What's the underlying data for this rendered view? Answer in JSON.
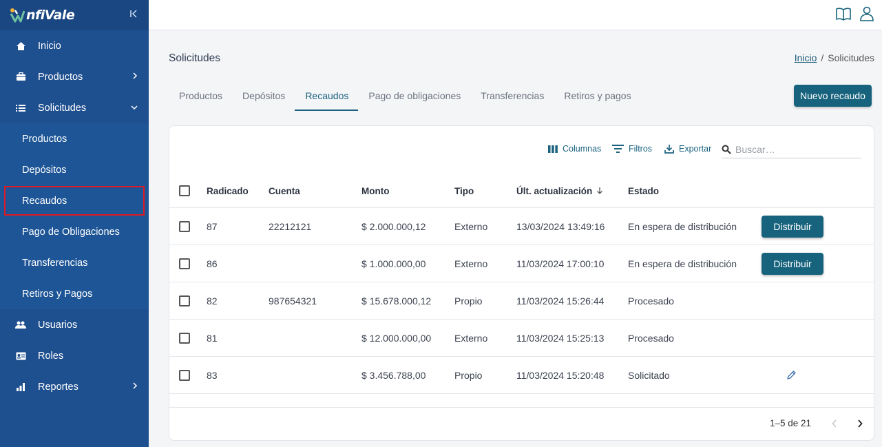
{
  "app": {
    "logo_text": "nfiVale",
    "brand_color": "#1e4f8f",
    "accent": "#17637d"
  },
  "sidebar": {
    "items": [
      {
        "label": "Inicio",
        "icon": "home-icon"
      },
      {
        "label": "Productos",
        "icon": "briefcase-icon"
      },
      {
        "label": "Solicitudes",
        "icon": "list-icon"
      }
    ],
    "subitems": [
      "Productos",
      "Depósitos",
      "Recaudos",
      "Pago de Obligaciones",
      "Transferencias",
      "Retiros y Pagos"
    ],
    "bottom_items": [
      {
        "label": "Usuarios",
        "icon": "users-icon"
      },
      {
        "label": "Roles",
        "icon": "id-card-icon"
      },
      {
        "label": "Reportes",
        "icon": "chart-icon"
      }
    ]
  },
  "page": {
    "title": "Solicitudes",
    "breadcrumb": {
      "home": "Inicio",
      "sep": "/",
      "current": "Solicitudes"
    }
  },
  "tabs": [
    "Productos",
    "Depósitos",
    "Recaudos",
    "Pago de obligaciones",
    "Transferencias",
    "Retiros y pagos"
  ],
  "actions": {
    "new_label": "Nuevo recaudo"
  },
  "toolbar": {
    "columns": "Columnas",
    "filters": "Filtros",
    "export": "Exportar",
    "search_placeholder": "Buscar…"
  },
  "table": {
    "headers": [
      "Radicado",
      "Cuenta",
      "Monto",
      "Tipo",
      "Últ. actualización",
      "Estado"
    ],
    "rows": [
      {
        "radicado": "87",
        "cuenta": "22212121",
        "monto": "$ 2.000.000,12",
        "tipo": "Externo",
        "fecha": "13/03/2024 13:49:16",
        "estado": "En espera de distribución",
        "action": "Distribuir"
      },
      {
        "radicado": "86",
        "cuenta": "",
        "monto": "$ 1.000.000,00",
        "tipo": "Externo",
        "fecha": "11/03/2024 17:00:10",
        "estado": "En espera de distribución",
        "action": "Distribuir"
      },
      {
        "radicado": "82",
        "cuenta": "987654321",
        "monto": "$ 15.678.000,12",
        "tipo": "Propio",
        "fecha": "11/03/2024 15:26:44",
        "estado": "Procesado",
        "action": ""
      },
      {
        "radicado": "81",
        "cuenta": "",
        "monto": "$ 12.000.000,00",
        "tipo": "Externo",
        "fecha": "11/03/2024 15:25:13",
        "estado": "Procesado",
        "action": ""
      },
      {
        "radicado": "83",
        "cuenta": "",
        "monto": "$ 3.456.788,00",
        "tipo": "Propio",
        "fecha": "11/03/2024 15:20:48",
        "estado": "Solicitado",
        "action": ""
      }
    ]
  },
  "pagination": {
    "label": "1–5 de 21"
  }
}
